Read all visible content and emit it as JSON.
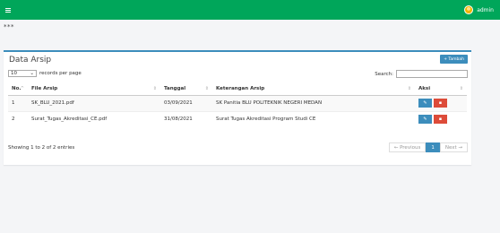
{
  "colors": {
    "header": "#00a65a",
    "primary": "#3c8dbc",
    "danger": "#dd4b39"
  },
  "header": {
    "user_name": "admin",
    "menu_icon": "hamburger-icon",
    "avatar_icon": "user-avatar-icon"
  },
  "breadcrumb": "***",
  "box": {
    "title": "Data Arsip",
    "add_button_label": "+ Tambah",
    "records_value": "10",
    "records_suffix": "records per page",
    "search_label": "Search:",
    "search_value": ""
  },
  "table": {
    "columns": [
      "No.",
      "File Arsip",
      "Tanggal",
      "Keterangan Arsip",
      "Aksi"
    ],
    "rows": [
      {
        "no": "1",
        "file": "SK_BLU_2021.pdf",
        "tanggal": "03/09/2021",
        "keterangan": "SK Panitia BLU POLITEKNIK NEGERI MEDAN"
      },
      {
        "no": "2",
        "file": "Surat_Tugas_Akreditasi_CE.pdf",
        "tanggal": "31/08/2021",
        "keterangan": "Surat Tugas Akreditasi Program Studi CE"
      }
    ],
    "actions": {
      "edit_icon": "edit-icon",
      "delete_icon": "trash-icon"
    }
  },
  "info": "Showing 1 to 2 of 2 entries",
  "pagination": {
    "previous": "← Previous",
    "current": "1",
    "next": "Next →"
  }
}
